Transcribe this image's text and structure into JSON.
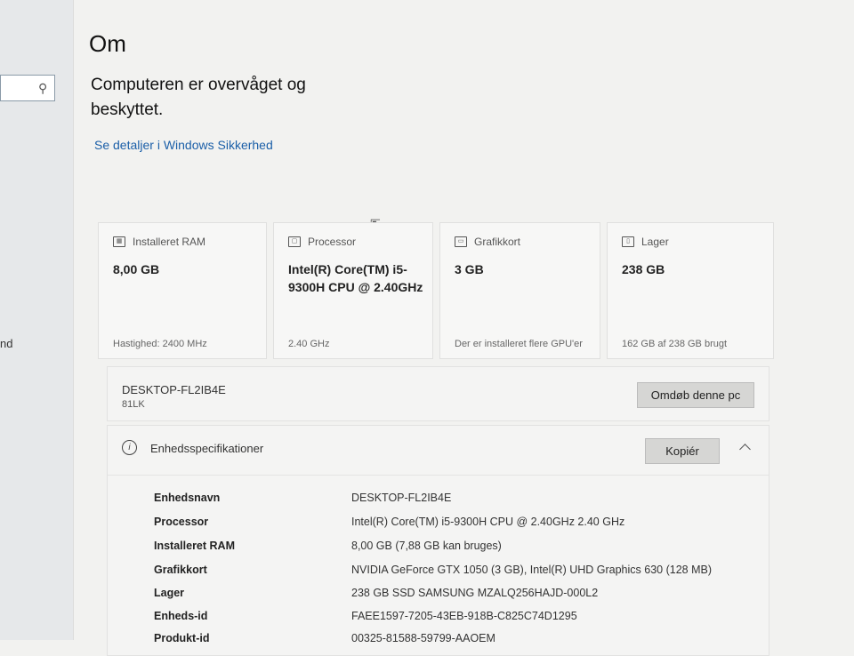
{
  "sidebar": {
    "search_icon": "search-icon",
    "fragment": "nd"
  },
  "page": {
    "title": "Om",
    "protection_text": "Computeren er overvåget og beskyttet.",
    "security_link": "Se detaljer i Windows Sikkerhed"
  },
  "cards": [
    {
      "icon": "ram-icon",
      "label": "Installeret RAM",
      "value": "8,00 GB",
      "footer": "Hastighed: 2400 MHz"
    },
    {
      "icon": "processor-icon",
      "label": "Processor",
      "value": "Intel(R) Core(TM) i5-9300H CPU @ 2.40GHz",
      "footer": "2.40 GHz"
    },
    {
      "icon": "graphics-card-icon",
      "label": "Grafikkort",
      "value": "3 GB",
      "footer": "Der er installeret flere GPU'er"
    },
    {
      "icon": "storage-icon",
      "label": "Lager",
      "value": "238 GB",
      "footer": "162 GB af 238 GB brugt"
    }
  ],
  "device": {
    "name": "DESKTOP-FL2IB4E",
    "model": "81LK",
    "rename_label": "Omdøb denne pc"
  },
  "specs": {
    "title": "Enhedsspecifikationer",
    "copy_label": "Kopiér",
    "rows": [
      {
        "label": "Enhedsnavn",
        "value": "DESKTOP-FL2IB4E"
      },
      {
        "label": "Processor",
        "value": "Intel(R) Core(TM) i5-9300H CPU @ 2.40GHz   2.40 GHz"
      },
      {
        "label": "Installeret RAM",
        "value": "8,00 GB (7,88 GB kan bruges)"
      },
      {
        "label": "Grafikkort",
        "value": "NVIDIA GeForce GTX 1050 (3 GB), Intel(R) UHD Graphics 630 (128 MB)"
      },
      {
        "label": "Lager",
        "value": "238 GB SSD SAMSUNG MZALQ256HAJD-000L2"
      },
      {
        "label": "Enheds-id",
        "value": "FAEE1597-7205-43EB-918B-C825C74D1295"
      },
      {
        "label": "Produkt-id",
        "value": "00325-81588-59799-AAOEM"
      }
    ]
  }
}
